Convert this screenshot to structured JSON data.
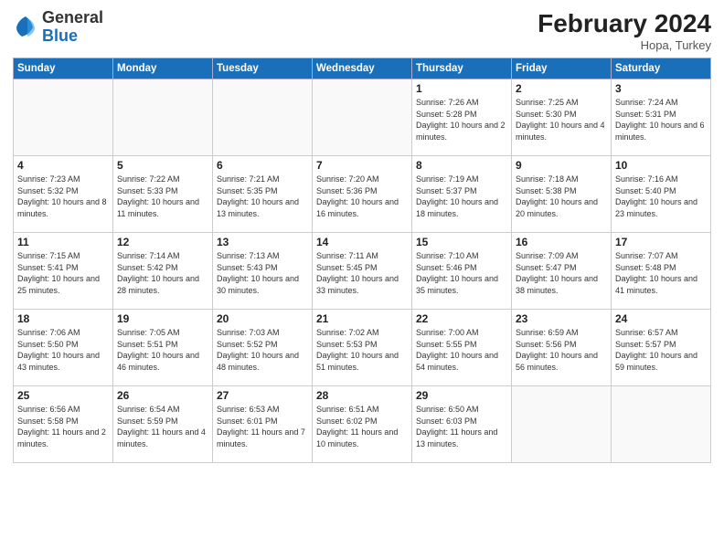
{
  "header": {
    "logo_general": "General",
    "logo_blue": "Blue",
    "month_year": "February 2024",
    "location": "Hopa, Turkey"
  },
  "days_of_week": [
    "Sunday",
    "Monday",
    "Tuesday",
    "Wednesday",
    "Thursday",
    "Friday",
    "Saturday"
  ],
  "weeks": [
    [
      {
        "day": "",
        "info": ""
      },
      {
        "day": "",
        "info": ""
      },
      {
        "day": "",
        "info": ""
      },
      {
        "day": "",
        "info": ""
      },
      {
        "day": "1",
        "info": "Sunrise: 7:26 AM\nSunset: 5:28 PM\nDaylight: 10 hours\nand 2 minutes."
      },
      {
        "day": "2",
        "info": "Sunrise: 7:25 AM\nSunset: 5:30 PM\nDaylight: 10 hours\nand 4 minutes."
      },
      {
        "day": "3",
        "info": "Sunrise: 7:24 AM\nSunset: 5:31 PM\nDaylight: 10 hours\nand 6 minutes."
      }
    ],
    [
      {
        "day": "4",
        "info": "Sunrise: 7:23 AM\nSunset: 5:32 PM\nDaylight: 10 hours\nand 8 minutes."
      },
      {
        "day": "5",
        "info": "Sunrise: 7:22 AM\nSunset: 5:33 PM\nDaylight: 10 hours\nand 11 minutes."
      },
      {
        "day": "6",
        "info": "Sunrise: 7:21 AM\nSunset: 5:35 PM\nDaylight: 10 hours\nand 13 minutes."
      },
      {
        "day": "7",
        "info": "Sunrise: 7:20 AM\nSunset: 5:36 PM\nDaylight: 10 hours\nand 16 minutes."
      },
      {
        "day": "8",
        "info": "Sunrise: 7:19 AM\nSunset: 5:37 PM\nDaylight: 10 hours\nand 18 minutes."
      },
      {
        "day": "9",
        "info": "Sunrise: 7:18 AM\nSunset: 5:38 PM\nDaylight: 10 hours\nand 20 minutes."
      },
      {
        "day": "10",
        "info": "Sunrise: 7:16 AM\nSunset: 5:40 PM\nDaylight: 10 hours\nand 23 minutes."
      }
    ],
    [
      {
        "day": "11",
        "info": "Sunrise: 7:15 AM\nSunset: 5:41 PM\nDaylight: 10 hours\nand 25 minutes."
      },
      {
        "day": "12",
        "info": "Sunrise: 7:14 AM\nSunset: 5:42 PM\nDaylight: 10 hours\nand 28 minutes."
      },
      {
        "day": "13",
        "info": "Sunrise: 7:13 AM\nSunset: 5:43 PM\nDaylight: 10 hours\nand 30 minutes."
      },
      {
        "day": "14",
        "info": "Sunrise: 7:11 AM\nSunset: 5:45 PM\nDaylight: 10 hours\nand 33 minutes."
      },
      {
        "day": "15",
        "info": "Sunrise: 7:10 AM\nSunset: 5:46 PM\nDaylight: 10 hours\nand 35 minutes."
      },
      {
        "day": "16",
        "info": "Sunrise: 7:09 AM\nSunset: 5:47 PM\nDaylight: 10 hours\nand 38 minutes."
      },
      {
        "day": "17",
        "info": "Sunrise: 7:07 AM\nSunset: 5:48 PM\nDaylight: 10 hours\nand 41 minutes."
      }
    ],
    [
      {
        "day": "18",
        "info": "Sunrise: 7:06 AM\nSunset: 5:50 PM\nDaylight: 10 hours\nand 43 minutes."
      },
      {
        "day": "19",
        "info": "Sunrise: 7:05 AM\nSunset: 5:51 PM\nDaylight: 10 hours\nand 46 minutes."
      },
      {
        "day": "20",
        "info": "Sunrise: 7:03 AM\nSunset: 5:52 PM\nDaylight: 10 hours\nand 48 minutes."
      },
      {
        "day": "21",
        "info": "Sunrise: 7:02 AM\nSunset: 5:53 PM\nDaylight: 10 hours\nand 51 minutes."
      },
      {
        "day": "22",
        "info": "Sunrise: 7:00 AM\nSunset: 5:55 PM\nDaylight: 10 hours\nand 54 minutes."
      },
      {
        "day": "23",
        "info": "Sunrise: 6:59 AM\nSunset: 5:56 PM\nDaylight: 10 hours\nand 56 minutes."
      },
      {
        "day": "24",
        "info": "Sunrise: 6:57 AM\nSunset: 5:57 PM\nDaylight: 10 hours\nand 59 minutes."
      }
    ],
    [
      {
        "day": "25",
        "info": "Sunrise: 6:56 AM\nSunset: 5:58 PM\nDaylight: 11 hours\nand 2 minutes."
      },
      {
        "day": "26",
        "info": "Sunrise: 6:54 AM\nSunset: 5:59 PM\nDaylight: 11 hours\nand 4 minutes."
      },
      {
        "day": "27",
        "info": "Sunrise: 6:53 AM\nSunset: 6:01 PM\nDaylight: 11 hours\nand 7 minutes."
      },
      {
        "day": "28",
        "info": "Sunrise: 6:51 AM\nSunset: 6:02 PM\nDaylight: 11 hours\nand 10 minutes."
      },
      {
        "day": "29",
        "info": "Sunrise: 6:50 AM\nSunset: 6:03 PM\nDaylight: 11 hours\nand 13 minutes."
      },
      {
        "day": "",
        "info": ""
      },
      {
        "day": "",
        "info": ""
      }
    ]
  ]
}
